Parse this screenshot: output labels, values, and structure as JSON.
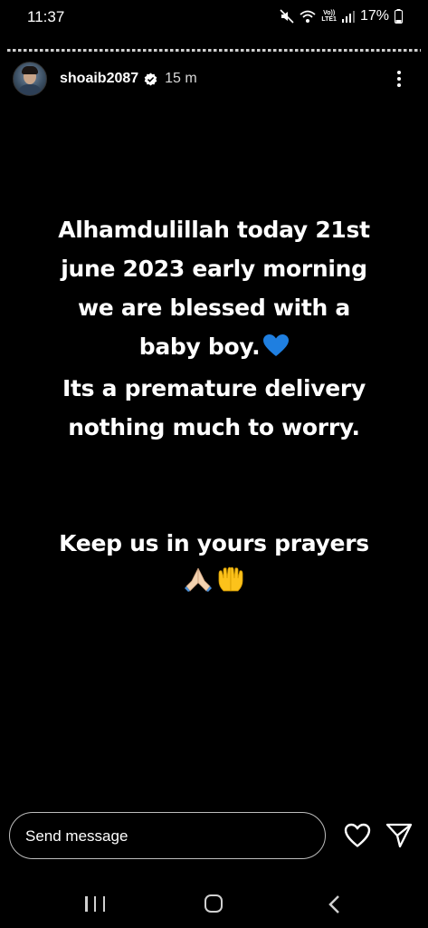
{
  "status_bar": {
    "time": "11:37",
    "network_label_top": "Vo))",
    "network_label_bottom": "LTE1",
    "battery": "17%"
  },
  "story": {
    "username": "shoaib2087",
    "time_ago": "15 m",
    "lines": [
      "Alhamdulillah today 21st",
      "june 2023 early morning",
      "we are blessed with a",
      "baby boy.",
      "Its a premature delivery",
      "nothing much to worry.",
      "Keep us in yours prayers"
    ]
  },
  "reply": {
    "placeholder": "Send message"
  },
  "icons": {
    "mute": "mute-icon",
    "wifi": "wifi-icon",
    "signal": "signal-icon",
    "battery": "battery-icon",
    "verified": "verified-badge-icon",
    "more": "more-vertical-icon",
    "heart_emoji": "blue-heart-emoji",
    "pray_emoji": "folded-hands-emoji",
    "raised_hands_emoji": "palms-up-together-emoji",
    "like": "heart-outline-icon",
    "share": "paper-plane-icon",
    "nav_recents": "recents-icon",
    "nav_home": "home-icon",
    "nav_back": "back-chevron-icon"
  },
  "colors": {
    "background": "#000000",
    "text": "#ffffff",
    "blue_heart": "#1f7fe0",
    "verified": "#ffffff",
    "emoji_skin": "#f3d2b0",
    "emoji_yellow": "#fcc21b"
  }
}
